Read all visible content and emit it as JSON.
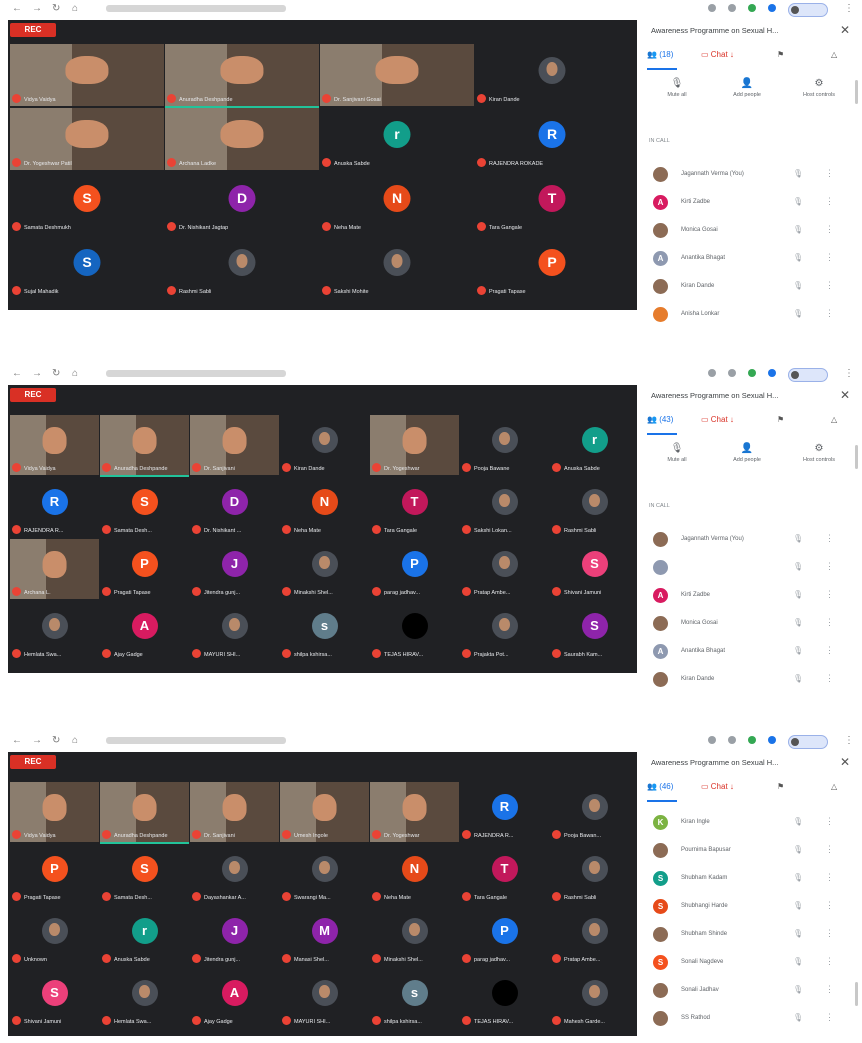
{
  "shots": [
    {
      "rec_label": "REC",
      "panel_title": "Awareness Programme on Sexual H...",
      "tabs": [
        "(18)",
        "Chat",
        "",
        ""
      ],
      "actions": [
        "Mute all",
        "Add people",
        "Host controls"
      ],
      "section": "IN CALL",
      "people": [
        {
          "name": "Jagannath Verma (You)",
          "initial": "",
          "color": "#8c6b55"
        },
        {
          "name": "Kirti Zadbe",
          "initial": "A",
          "color": "#d81b60"
        },
        {
          "name": "Monica Gosai",
          "initial": "",
          "color": "#8c6b55"
        },
        {
          "name": "Anantika Bhagat",
          "initial": "A",
          "color": "#8e99b0"
        },
        {
          "name": "Kiran Dande",
          "initial": "",
          "color": "#8c6b55"
        },
        {
          "name": "Anisha Lonkar",
          "initial": "",
          "color": "#e67c2c"
        }
      ],
      "tiles": [
        {
          "name": "Vidya Vaidya",
          "kind": "video"
        },
        {
          "name": "Anuradha Deshpande",
          "kind": "video"
        },
        {
          "name": "Dr. Sanjivani Gosai",
          "kind": "video"
        },
        {
          "name": "Kiran Dande",
          "kind": "photo"
        },
        {
          "name": "Dr. Yogeshwar Patil",
          "kind": "video"
        },
        {
          "name": "Archana Ladke",
          "kind": "video"
        },
        {
          "name": "Anuska Sabde",
          "kind": "letter",
          "letter": "r",
          "color": "#129e8a"
        },
        {
          "name": "RAJENDRA ROKADE",
          "kind": "letter",
          "letter": "R",
          "color": "#1a73e8"
        },
        {
          "name": "Samata Deshmukh",
          "kind": "letter",
          "letter": "S",
          "color": "#f4511e"
        },
        {
          "name": "Dr. Nishikant Jagtap",
          "kind": "letter",
          "letter": "D",
          "color": "#8e24aa"
        },
        {
          "name": "Neha Mate",
          "kind": "letter",
          "letter": "N",
          "color": "#e64a19"
        },
        {
          "name": "Tara Gangale",
          "kind": "letter",
          "letter": "T",
          "color": "#c2185b"
        },
        {
          "name": "Sujal Mahadik",
          "kind": "letter",
          "letter": "S",
          "color": "#1565c0"
        },
        {
          "name": "Rashmi Sabli",
          "kind": "photo"
        },
        {
          "name": "Sakshi Mohite",
          "kind": "photo"
        },
        {
          "name": "Pragati Tapase",
          "kind": "letter",
          "letter": "P",
          "color": "#f4511e"
        }
      ]
    },
    {
      "rec_label": "REC",
      "panel_title": "Awareness Programme on Sexual H...",
      "tabs": [
        "(43)",
        "Chat",
        "",
        ""
      ],
      "actions": [
        "Mute all",
        "Add people",
        "Host controls"
      ],
      "section": "IN CALL",
      "people": [
        {
          "name": "Jagannath Verma (You)",
          "initial": "",
          "color": "#8c6b55"
        },
        {
          "name": "",
          "initial": "",
          "color": "#8e99b0"
        },
        {
          "name": "Kirti Zadbe",
          "initial": "A",
          "color": "#d81b60"
        },
        {
          "name": "Monica Gosai",
          "initial": "",
          "color": "#8c6b55"
        },
        {
          "name": "Anantika Bhagat",
          "initial": "A",
          "color": "#8e99b0"
        },
        {
          "name": "Kiran Dande",
          "initial": "",
          "color": "#8c6b55"
        }
      ],
      "tiles": [
        {
          "name": "Vidya Vaidya",
          "kind": "video"
        },
        {
          "name": "Anuradha Deshpande",
          "kind": "video"
        },
        {
          "name": "Dr. Sanjivani",
          "kind": "video"
        },
        {
          "name": "Kiran Dande",
          "kind": "photo"
        },
        {
          "name": "Dr. Yogeshwar",
          "kind": "video"
        },
        {
          "name": "Pooja Bawane",
          "kind": "photo"
        },
        {
          "name": "Anuska Sabde",
          "kind": "letter",
          "letter": "r",
          "color": "#129e8a"
        },
        {
          "name": "RAJENDRA R...",
          "kind": "letter",
          "letter": "R",
          "color": "#1a73e8"
        },
        {
          "name": "Samata Desh...",
          "kind": "letter",
          "letter": "S",
          "color": "#f4511e"
        },
        {
          "name": "Dr. Nishikant ...",
          "kind": "letter",
          "letter": "D",
          "color": "#8e24aa"
        },
        {
          "name": "Neha Mate",
          "kind": "letter",
          "letter": "N",
          "color": "#e64a19"
        },
        {
          "name": "Tara Gangale",
          "kind": "letter",
          "letter": "T",
          "color": "#c2185b"
        },
        {
          "name": "Sakshi Lokan...",
          "kind": "photo"
        },
        {
          "name": "Rashmi Sabli",
          "kind": "photo"
        },
        {
          "name": "Archana L.",
          "kind": "video"
        },
        {
          "name": "Pragati Tapase",
          "kind": "letter",
          "letter": "P",
          "color": "#f4511e"
        },
        {
          "name": "Jitendra gunj...",
          "kind": "letter",
          "letter": "J",
          "color": "#8e24aa"
        },
        {
          "name": "Minakshi Shel...",
          "kind": "photo"
        },
        {
          "name": "parag jadhav...",
          "kind": "letter",
          "letter": "P",
          "color": "#1a73e8"
        },
        {
          "name": "Pratap Ambe...",
          "kind": "photo"
        },
        {
          "name": "Shivani Jamuni",
          "kind": "letter",
          "letter": "S",
          "color": "#ec407a"
        },
        {
          "name": "Hemlata Swa...",
          "kind": "photo"
        },
        {
          "name": "Ajay Gadge",
          "kind": "letter",
          "letter": "A",
          "color": "#d81b60"
        },
        {
          "name": "MAYURI SHI...",
          "kind": "photo"
        },
        {
          "name": "shilpa kshirsa...",
          "kind": "letter",
          "letter": "s",
          "color": "#607d8b"
        },
        {
          "name": "TEJAS HIRAV...",
          "kind": "dark"
        },
        {
          "name": "Prajakta Pot...",
          "kind": "photo"
        },
        {
          "name": "Saurabh Kam...",
          "kind": "letter",
          "letter": "S",
          "color": "#8e24aa"
        }
      ]
    },
    {
      "rec_label": "REC",
      "panel_title": "Awareness Programme on Sexual H...",
      "tabs": [
        "(46)",
        "Chat",
        "",
        ""
      ],
      "actions": [],
      "section": "",
      "people": [
        {
          "name": "Kiran Ingle",
          "initial": "K",
          "color": "#7cb342"
        },
        {
          "name": "Pournima Bapusar",
          "initial": "",
          "color": "#8c6b55"
        },
        {
          "name": "Shubham Kadam",
          "initial": "S",
          "color": "#129e8a"
        },
        {
          "name": "Shubhangi Harde",
          "initial": "S",
          "color": "#e64a19"
        },
        {
          "name": "Shubham Shinde",
          "initial": "",
          "color": "#8c6b55"
        },
        {
          "name": "Sonali Nagdeve",
          "initial": "S",
          "color": "#f4511e"
        },
        {
          "name": "Sonali Jadhav",
          "initial": "",
          "color": "#8c6b55"
        },
        {
          "name": "SS Rathod",
          "initial": "",
          "color": "#8c6b55"
        }
      ],
      "tiles": [
        {
          "name": "Vidya Vaidya",
          "kind": "video"
        },
        {
          "name": "Anuradha Deshpande",
          "kind": "video"
        },
        {
          "name": "Dr. Sanjivani",
          "kind": "video"
        },
        {
          "name": "Umesh Ingole",
          "kind": "video"
        },
        {
          "name": "Dr. Yogeshwar",
          "kind": "video"
        },
        {
          "name": "RAJENDRA R...",
          "kind": "letter",
          "letter": "R",
          "color": "#1a73e8"
        },
        {
          "name": "Pooja Bawan...",
          "kind": "photo"
        },
        {
          "name": "Pragati Tapase",
          "kind": "letter",
          "letter": "P",
          "color": "#f4511e"
        },
        {
          "name": "Samata Desh...",
          "kind": "letter",
          "letter": "S",
          "color": "#f4511e"
        },
        {
          "name": "Dayashankar A...",
          "kind": "photo"
        },
        {
          "name": "Swarangi Ma...",
          "kind": "photo"
        },
        {
          "name": "Neha Mate",
          "kind": "letter",
          "letter": "N",
          "color": "#e64a19"
        },
        {
          "name": "Tara Gangale",
          "kind": "letter",
          "letter": "T",
          "color": "#c2185b"
        },
        {
          "name": "Rashmi Sabli",
          "kind": "photo"
        },
        {
          "name": "Unknown",
          "kind": "photo"
        },
        {
          "name": "Anuska Sabde",
          "kind": "letter",
          "letter": "r",
          "color": "#129e8a"
        },
        {
          "name": "Jitendra gunj...",
          "kind": "letter",
          "letter": "J",
          "color": "#8e24aa"
        },
        {
          "name": "Manasi Shel...",
          "kind": "letter",
          "letter": "M",
          "color": "#8e24aa"
        },
        {
          "name": "Minakshi Shel...",
          "kind": "photo"
        },
        {
          "name": "parag jadhav...",
          "kind": "letter",
          "letter": "P",
          "color": "#1a73e8"
        },
        {
          "name": "Pratap Ambe...",
          "kind": "photo"
        },
        {
          "name": "Shivani Jamuni",
          "kind": "letter",
          "letter": "S",
          "color": "#ec407a"
        },
        {
          "name": "Hemlata Swa...",
          "kind": "photo"
        },
        {
          "name": "Ajay Gadge",
          "kind": "letter",
          "letter": "A",
          "color": "#d81b60"
        },
        {
          "name": "MAYURI SHI...",
          "kind": "photo"
        },
        {
          "name": "shilpa kshirsa...",
          "kind": "letter",
          "letter": "s",
          "color": "#607d8b"
        },
        {
          "name": "TEJAS HIRAV...",
          "kind": "dark"
        },
        {
          "name": "Mahesh Garde...",
          "kind": "photo"
        }
      ]
    }
  ]
}
